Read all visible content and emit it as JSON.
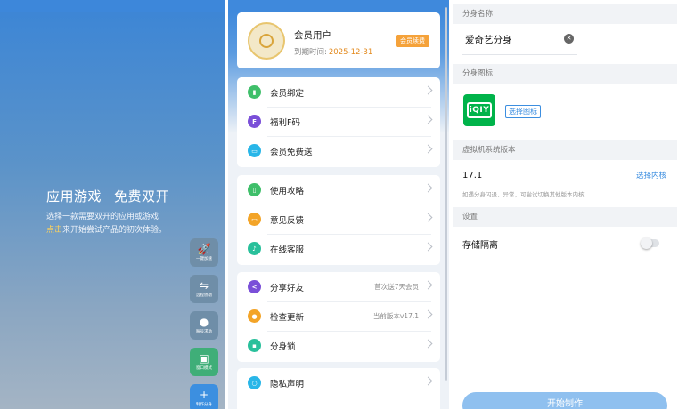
{
  "home": {
    "title_part1": "应用游戏",
    "title_part2": "免费双开",
    "subtitle_line1": "选择一款需要双开的应用或游戏",
    "subtitle_accent": "点击",
    "subtitle_line2_rest": "来开始尝试产品的初次体验。",
    "side_buttons": [
      {
        "label": "一键加速",
        "icon": "rocket-icon",
        "glyph": "🚀"
      },
      {
        "label": "远程协助",
        "icon": "transfer-icon",
        "glyph": "⇋"
      },
      {
        "label": "账号求助",
        "icon": "chat-icon",
        "glyph": "●"
      },
      {
        "label": "窗口模式",
        "icon": "window-icon",
        "glyph": "▣"
      },
      {
        "label": "制作分身",
        "icon": "plus-icon",
        "glyph": "+"
      }
    ]
  },
  "profile": {
    "name": "会员用户",
    "expiry_label": "到期时间:",
    "expiry_date": "2025-12-31",
    "renew_label": "会员续费"
  },
  "menu_groups": [
    [
      {
        "label": "会员绑定",
        "color": "#3fbf6a",
        "glyph": "▮",
        "right": ""
      },
      {
        "label": "福利F码",
        "color": "#7a4fd8",
        "glyph": "F",
        "right": ""
      },
      {
        "label": "会员免费送",
        "color": "#29b6e8",
        "glyph": "▭",
        "right": ""
      }
    ],
    [
      {
        "label": "使用攻略",
        "color": "#3fbf6a",
        "glyph": "▯",
        "right": ""
      },
      {
        "label": "意见反馈",
        "color": "#f3a428",
        "glyph": "▭",
        "right": ""
      },
      {
        "label": "在线客服",
        "color": "#29c09b",
        "glyph": "♪",
        "right": ""
      }
    ],
    [
      {
        "label": "分享好友",
        "color": "#7a4fd8",
        "glyph": "<",
        "right": "首次送7天会员"
      },
      {
        "label": "检查更新",
        "color": "#f3a428",
        "glyph": "●",
        "right": "当前版本v17.1"
      },
      {
        "label": "分身锁",
        "color": "#29c09b",
        "glyph": "▪",
        "right": ""
      }
    ],
    [
      {
        "label": "隐私声明",
        "color": "#29b6e8",
        "glyph": "○",
        "right": ""
      }
    ]
  ],
  "clone": {
    "name_header": "分身名称",
    "name_value": "爱奇艺分身",
    "icon_header": "分身图标",
    "app_icon_text": "iQIY",
    "choose_icon": "选择图标",
    "system_header": "虚拟机系统版本",
    "version": "17.1",
    "choose_kernel": "选择内核",
    "version_hint": "如遇分身闪退、异常，可尝试切换其他版本内核",
    "settings_header": "设置",
    "storage_label": "存储隔离",
    "storage_enabled": false,
    "start_button": "开始制作"
  },
  "colors": {
    "accent": "#3c8ee0",
    "orange": "#f5a23a",
    "app_green": "#00b34a"
  }
}
